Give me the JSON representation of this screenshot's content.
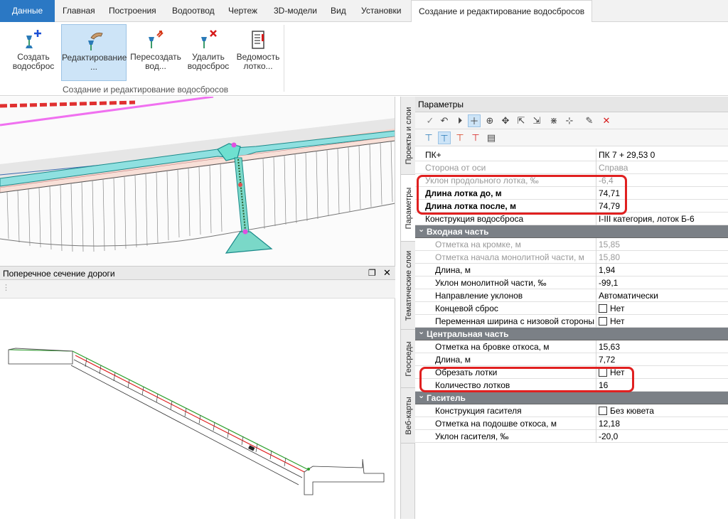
{
  "ribbon": {
    "tabs": [
      "Данные",
      "Главная",
      "Построения",
      "Водоотвод",
      "Чертеж",
      "3D-модели",
      "Вид",
      "Установки",
      "Создание и редактирование водосбросов"
    ],
    "buttons": [
      {
        "line1": "Создать",
        "line2": "водосброс"
      },
      {
        "line1": "Редактирование",
        "line2": "..."
      },
      {
        "line1": "Пересоздать",
        "line2": "вод..."
      },
      {
        "line1": "Удалить",
        "line2": "водосброс"
      },
      {
        "line1": "Ведомость",
        "line2": "лотко..."
      }
    ],
    "group_label": "Создание и редактирование водосбросов"
  },
  "section": {
    "title": "Поперечное сечение дороги"
  },
  "vertical_tabs": [
    "Проекты и слои",
    "Параметры",
    "Тематические слои",
    "Геосреды",
    "Веб-карты"
  ],
  "panel": {
    "title": "Параметры",
    "rows": [
      {
        "type": "row",
        "name": "ПК+",
        "value": "ПК     7 + 29,53  0"
      },
      {
        "type": "row",
        "name": "Сторона от оси",
        "value": "Справа",
        "disabled": true
      },
      {
        "type": "row",
        "name": "Уклон продольного лотка, ‰",
        "value": "-6,4",
        "disabled": true
      },
      {
        "type": "row",
        "name": "Длина лотка до, м",
        "value": "74,71",
        "bold": true
      },
      {
        "type": "row",
        "name": "Длина лотка после, м",
        "value": "74,79",
        "bold": true
      },
      {
        "type": "row",
        "name": "Конструкция водосброса",
        "value": "I-III категория, лоток Б-6"
      },
      {
        "type": "cat",
        "name": "Входная часть"
      },
      {
        "type": "row",
        "name": "Отметка на кромке, м",
        "value": "15,85",
        "disabled": true,
        "sub": true
      },
      {
        "type": "row",
        "name": "Отметка начала монолитной части, м",
        "value": "15,80",
        "disabled": true,
        "sub": true
      },
      {
        "type": "row",
        "name": "Длина, м",
        "value": "1,94",
        "sub": true
      },
      {
        "type": "row",
        "name": "Уклон монолитной части, ‰",
        "value": "-99,1",
        "sub": true
      },
      {
        "type": "row",
        "name": "Направление уклонов",
        "value": "Автоматически",
        "sub": true
      },
      {
        "type": "row",
        "name": "Концевой сброс",
        "value": "Нет",
        "check": true,
        "sub": true
      },
      {
        "type": "row",
        "name": "Переменная ширина с низовой стороны",
        "value": "Нет",
        "check": true,
        "sub": true
      },
      {
        "type": "cat",
        "name": "Центральная часть"
      },
      {
        "type": "row",
        "name": "Отметка на бровке откоса, м",
        "value": "15,63",
        "sub": true
      },
      {
        "type": "row",
        "name": "Длина, м",
        "value": "7,72",
        "sub": true
      },
      {
        "type": "row",
        "name": "Обрезать лотки",
        "value": "Нет",
        "check": true,
        "sub": true
      },
      {
        "type": "row",
        "name": "Количество лотков",
        "value": "16",
        "sub": true
      },
      {
        "type": "cat",
        "name": "Гаситель"
      },
      {
        "type": "row",
        "name": "Конструкция гасителя",
        "value": "Без кювета",
        "check": true,
        "sub": true
      },
      {
        "type": "row",
        "name": "Отметка на подошве откоса, м",
        "value": "12,18",
        "sub": true
      },
      {
        "type": "row",
        "name": "Уклон гасителя, ‰",
        "value": "-20,0",
        "sub": true
      }
    ]
  },
  "colors": {
    "accent": "#2b78c4",
    "highlight": "#e02020",
    "category": "#7b8086",
    "selected": "#cde4f7"
  }
}
